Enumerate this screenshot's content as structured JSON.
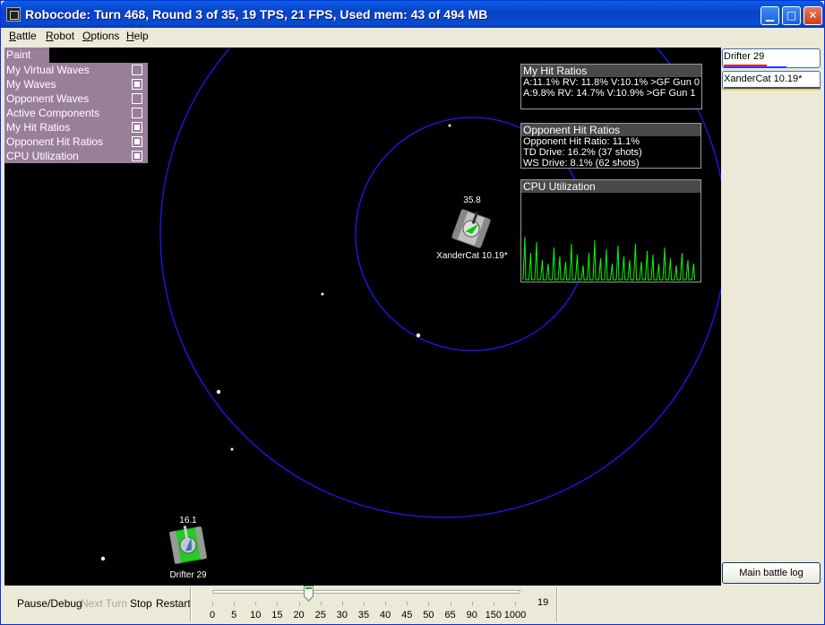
{
  "window": {
    "title": "Robocode: Turn 468, Round 3 of 35, 19 TPS, 21 FPS, Used mem: 43 of 494 MB",
    "controls": [
      "minimize",
      "maximize",
      "close"
    ]
  },
  "menubar": {
    "items": [
      {
        "label": "Battle",
        "mnemonic": "B"
      },
      {
        "label": "Robot",
        "mnemonic": "R"
      },
      {
        "label": "Options",
        "mnemonic": "O"
      },
      {
        "label": "Help",
        "mnemonic": "H"
      }
    ]
  },
  "paint_panel": {
    "title": "Paint",
    "items": [
      {
        "label": "My Virtual Waves",
        "checked": false
      },
      {
        "label": "My Waves",
        "checked": true
      },
      {
        "label": "Opponent Waves",
        "checked": false
      },
      {
        "label": "Active Components",
        "checked": false
      },
      {
        "label": "My Hit Ratios",
        "checked": true
      },
      {
        "label": "Opponent Hit Ratios",
        "checked": true
      },
      {
        "label": "CPU Utilization",
        "checked": true
      }
    ]
  },
  "my_hit_ratios": {
    "title": "My Hit Ratios",
    "lines": [
      "A:11.1% RV: 11.8% V:10.1% >GF Gun 0",
      "A:9.8% RV: 14.7% V:10.9% >GF Gun 1"
    ]
  },
  "opponent_hit_ratios": {
    "title": "Opponent Hit Ratios",
    "lines": [
      "Opponent Hit Ratio: 11.1%",
      "TD Drive: 16.2% (37 shots)",
      "WS Drive: 8.1% (62 shots)"
    ]
  },
  "cpu_utilization": {
    "title": "CPU Utilization",
    "color": "#00ff00"
  },
  "robots": [
    {
      "name": "XanderCat 10.19*",
      "energy": "35.8",
      "body_color": "#c0c0c0",
      "accent_color": "#00cc00"
    },
    {
      "name": "Drifter 29",
      "energy": "16.1",
      "body_color": "#22cc22",
      "accent_color": "#c0c0c0"
    }
  ],
  "colors": {
    "battlefield": "#000000",
    "wave": "#1a1aff",
    "paint_panel_bg": "#9a7f9a"
  },
  "sidebar": {
    "robots": [
      {
        "label": "Drifter 29",
        "bar_color": "#ff2020",
        "bar2_color": "#2040ff"
      },
      {
        "label": "XanderCat 10.19*",
        "bar_color": "#2040ff",
        "bar2_color": "#ffd700"
      }
    ],
    "main_log_label": "Main battle log"
  },
  "controls": {
    "pause": "Pause/Debug",
    "next_turn": "Next Turn",
    "stop": "Stop",
    "restart": "Restart",
    "tps_value": "19",
    "tps_ticks": [
      "0",
      "5",
      "10",
      "15",
      "20",
      "25",
      "30",
      "35",
      "40",
      "45",
      "50",
      "65",
      "90",
      "150",
      "1000"
    ]
  }
}
